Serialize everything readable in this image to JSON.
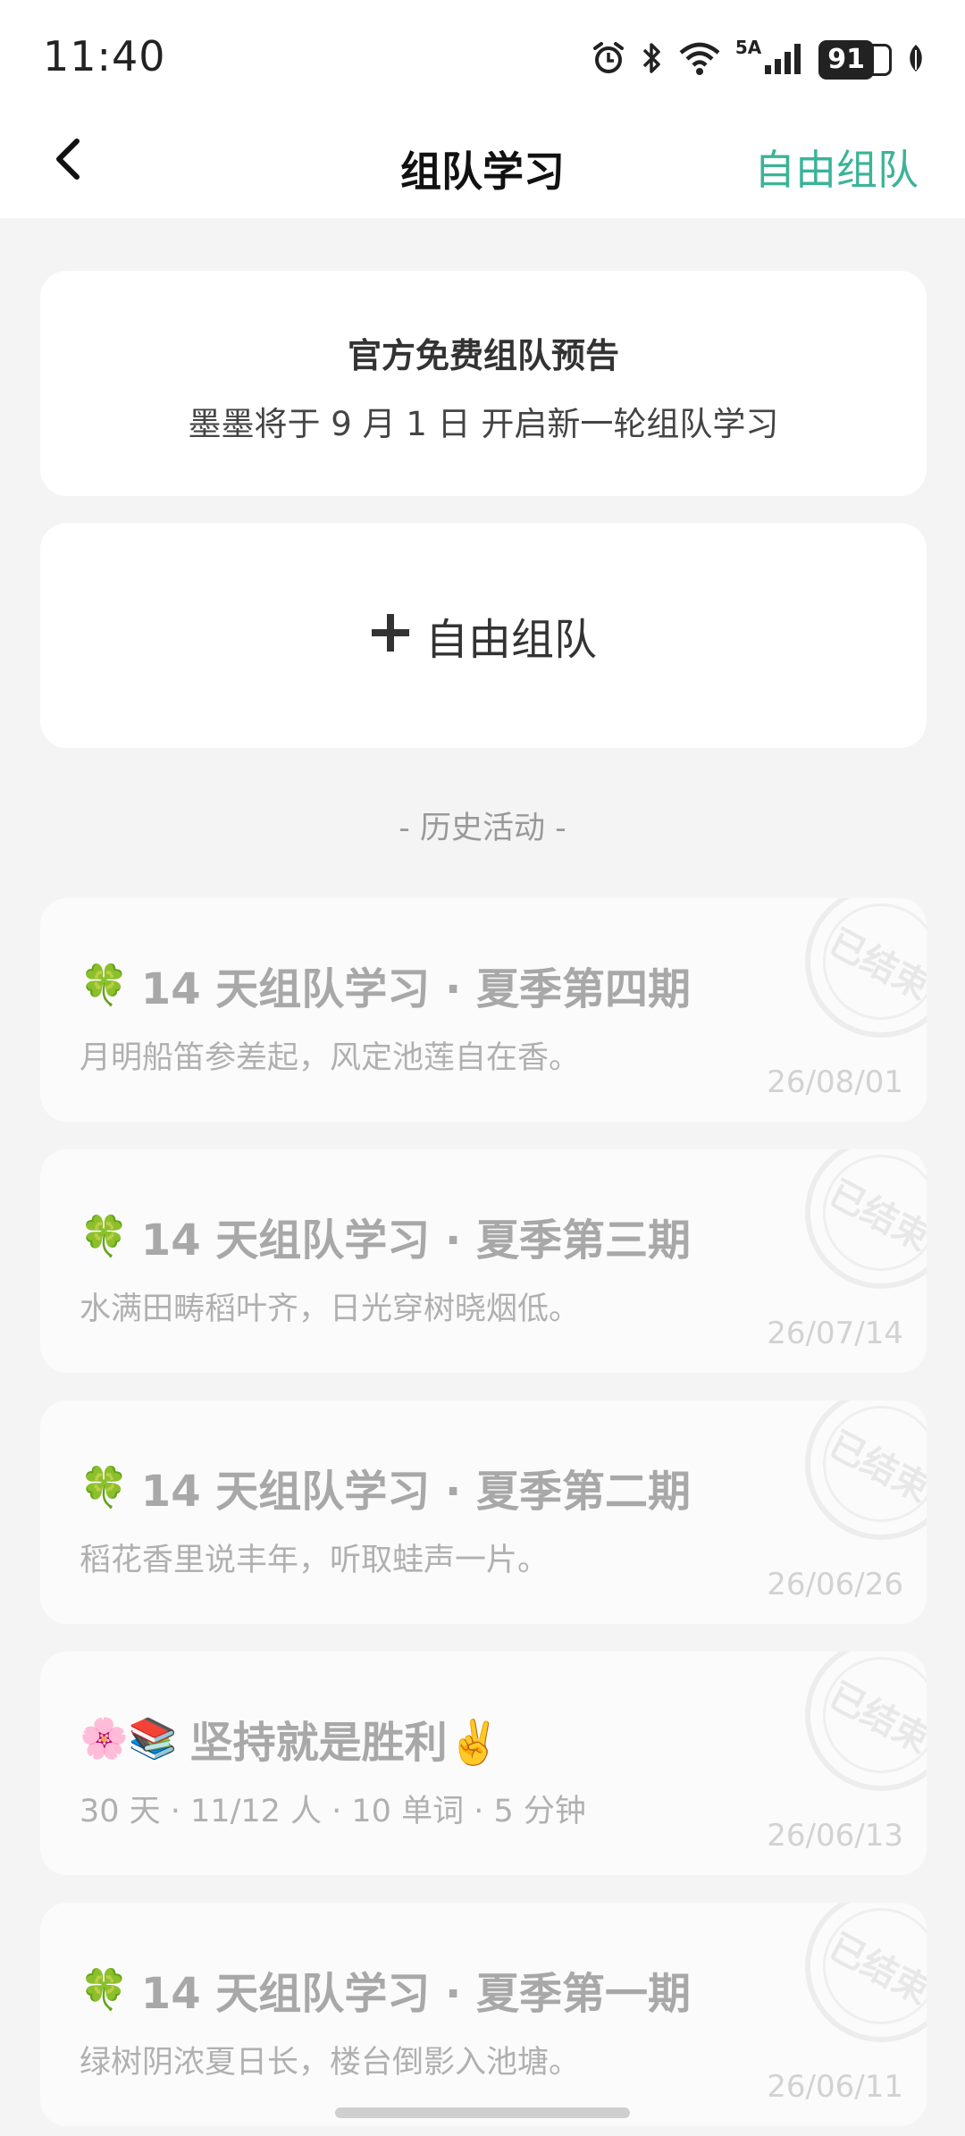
{
  "status_bar": {
    "time": "11:40",
    "network": "5A",
    "battery": "91"
  },
  "nav": {
    "title": "组队学习",
    "action": "自由组队"
  },
  "announcement": {
    "title": "官方免费组队预告",
    "subtitle": "墨墨将于 9 月 1 日 开启新一轮组队学习"
  },
  "free_team": {
    "label": "自由组队"
  },
  "history": {
    "label": "- 历史活动 -",
    "stamp_text": "已结束",
    "items": [
      {
        "emoji": "🍀",
        "title": "14 天组队学习 · 夏季第四期",
        "subtitle": "月明船笛参差起，风定池莲自在香。",
        "date": "26/08/01"
      },
      {
        "emoji": "🍀",
        "title": "14 天组队学习 · 夏季第三期",
        "subtitle": "水满田畴稻叶齐，日光穿树晓烟低。",
        "date": "26/07/14"
      },
      {
        "emoji": "🍀",
        "title": "14 天组队学习 · 夏季第二期",
        "subtitle": "稻花香里说丰年，听取蛙声一片。",
        "date": "26/06/26"
      },
      {
        "emoji": "🌸📚",
        "title": "坚持就是胜利✌️",
        "subtitle": "30 天 · 11/12 人 · 10 单词 · 5 分钟",
        "date": "26/06/13"
      },
      {
        "emoji": "🍀",
        "title": "14 天组队学习 · 夏季第一期",
        "subtitle": "绿树阴浓夏日长，楼台倒影入池塘。",
        "date": "26/06/11"
      }
    ]
  }
}
